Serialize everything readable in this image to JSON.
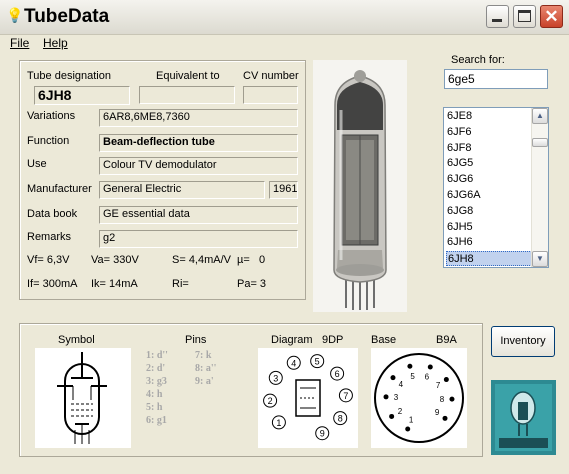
{
  "app": {
    "title": "TubeData"
  },
  "menu": {
    "file": "File",
    "help": "Help"
  },
  "labels": {
    "tube_designation": "Tube designation",
    "equivalent_to": "Equivalent to",
    "cv_number": "CV number",
    "variations": "Variations",
    "function": "Function",
    "use": "Use",
    "manufacturer": "Manufacturer",
    "data_book": "Data book",
    "remarks": "Remarks",
    "search_for": "Search for:",
    "symbol": "Symbol",
    "pins": "Pins",
    "diagram": "Diagram",
    "diagram_code": "9DP",
    "base": "Base",
    "base_code": "B9A"
  },
  "tube": {
    "designation": "6JH8",
    "equivalent": "",
    "cv_number": "",
    "variations": "6AR8,6ME8,7360",
    "function": "Beam-deflection tube",
    "use": "Colour TV demodulator",
    "manufacturer": "General Electric",
    "year": "1961",
    "data_book": "GE essential data",
    "remarks": "g2",
    "params_row1": {
      "vf": "Vf= 6,3V",
      "va": "Va= 330V",
      "s": "S= 4,4mA/V",
      "mu": "µ=",
      "mu_val": "0"
    },
    "params_row2": {
      "if": "If= 300mA",
      "ik": "Ik= 14mA",
      "ri": "Ri=",
      "pa": "Pa= 3"
    }
  },
  "search": {
    "value": "6ge5",
    "placeholder": ""
  },
  "tube_list": [
    "6JE8",
    "6JF6",
    "6JF8",
    "6JG5",
    "6JG6",
    "6JG6A",
    "6JG8",
    "6JH5",
    "6JH6",
    "6JH8"
  ],
  "selected_tube": "6JH8",
  "pins": {
    "col1": [
      "1: d''",
      "2: d'",
      "3: g3",
      "4: h",
      "5: h",
      "6: g1"
    ],
    "col2": [
      "7: k",
      "8: a''",
      "9: a'"
    ]
  },
  "diagram_pins": [
    "1",
    "2",
    "3",
    "4",
    "5",
    "6",
    "7",
    "8",
    "9"
  ],
  "base_pins": [
    "1",
    "2",
    "3",
    "4",
    "5",
    "6",
    "7",
    "8",
    "9"
  ],
  "buttons": {
    "inventory": "Inventory"
  },
  "window_controls": {
    "close": "✕"
  }
}
